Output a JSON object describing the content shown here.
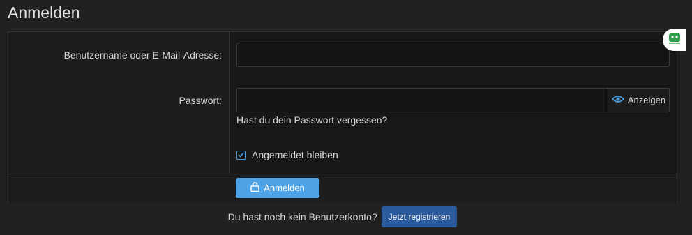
{
  "page": {
    "title": "Anmelden"
  },
  "form": {
    "username_label": "Benutzername oder E-Mail-Adresse:",
    "username_value": "",
    "password_label": "Passwort:",
    "password_value": "",
    "show_password_label": "Anzeigen",
    "forgot_password_link": "Hast du dein Passwort vergessen?",
    "remember_me_label": "Angemeldet bleiben",
    "remember_me_checked": true,
    "submit_label": "Anmelden"
  },
  "register": {
    "prompt": "Du hast noch kein Benutzerkonto?",
    "button_label": "Jetzt registrieren"
  },
  "icons": {
    "eye": "eye-icon",
    "lock": "lock-icon",
    "check": "checkmark-icon",
    "bot": "bot-icon"
  },
  "colors": {
    "accent": "#4da3e6",
    "register_button": "#2b5a9c",
    "background": "#212121"
  }
}
